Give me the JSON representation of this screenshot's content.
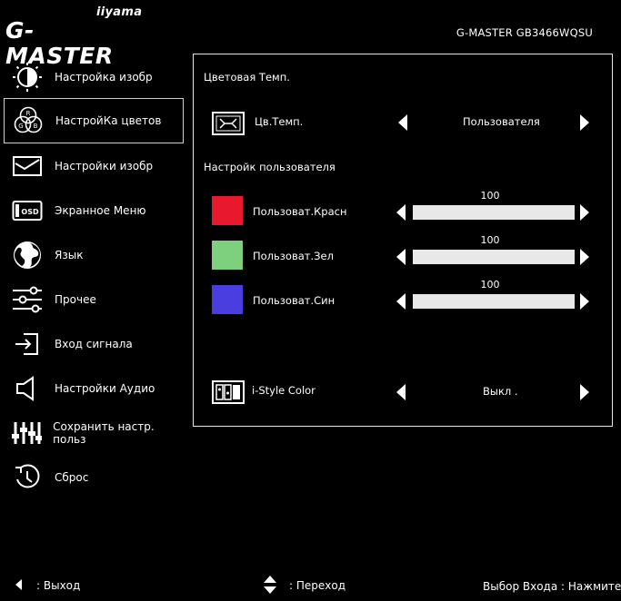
{
  "header": {
    "brand_top": "iiyama",
    "brand_main": "G-MASTER",
    "model": "G-MASTER   GB3466WQSU"
  },
  "sidebar": {
    "items": [
      {
        "label": "Настройка изобр",
        "icon": "brightness-contrast-icon"
      },
      {
        "label": "НастройКа цветов",
        "icon": "rgb-color-icon",
        "selected": true
      },
      {
        "label": "Настройки изобр",
        "icon": "image-frame-icon"
      },
      {
        "label": "Экранное Меню",
        "icon": "osd-icon"
      },
      {
        "label": "Язык",
        "icon": "globe-icon"
      },
      {
        "label": "Прочее",
        "icon": "sliders-icon"
      },
      {
        "label": "Вход сигнала",
        "icon": "input-signal-icon"
      },
      {
        "label": "Настройки Аудио",
        "icon": "speaker-icon"
      },
      {
        "label": "Сохранить настр. польз",
        "icon": "save-settings-icon"
      },
      {
        "label": "Сброс",
        "icon": "reset-icon"
      }
    ]
  },
  "panel": {
    "section_color_temp": "Цветовая Темп.",
    "color_temp": {
      "label": "Цв.Темп.",
      "value": "Пользователя",
      "icon": "color-temp-icon"
    },
    "section_user": "Настройк пользователя",
    "user_colors": [
      {
        "label": "Пользоват.Красн",
        "value": "100",
        "level": 1.0,
        "color": "#e8192c"
      },
      {
        "label": "Пользоват.Зел",
        "value": "100",
        "level": 1.0,
        "color": "#7ed07e"
      },
      {
        "label": "Пользоват.Син",
        "value": "100",
        "level": 1.0,
        "color": "#4a3ee0"
      }
    ],
    "istyle": {
      "label": "i-Style Color",
      "value": "Выкл .",
      "icon": "istyle-color-icon"
    }
  },
  "footer": {
    "exit": ": Выход",
    "navigate": ": Переход",
    "select": "Выбор Входа : Нажмите"
  }
}
